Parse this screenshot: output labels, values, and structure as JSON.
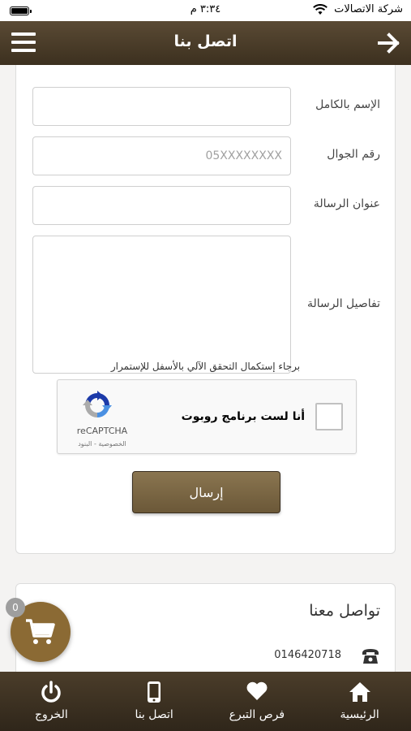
{
  "status_bar": {
    "carrier": "شركة الاتصالات",
    "time": "٣:٣٤ م"
  },
  "header": {
    "title": "اتصل بنا",
    "menu_icon": "hamburger-menu-icon",
    "back_icon": "arrow-right-icon"
  },
  "form": {
    "fields": [
      {
        "label": "الإسم بالكامل",
        "value": "",
        "placeholder": ""
      },
      {
        "label": "رقم الجوال",
        "value": "",
        "placeholder": "05XXXXXXXX"
      },
      {
        "label": "عنوان الرسالة",
        "value": "",
        "placeholder": ""
      }
    ],
    "details_label": "تفاصيل الرسالة",
    "captcha_hint": "برجاء إستكمال التحقق الآلي بالأسفل للإستمرار",
    "recaptcha": {
      "label": "أنا لست برنامج روبوت",
      "brand": "reCAPTCHA",
      "links": "الخصوصية - البنود",
      "checked": false
    },
    "submit_label": "إرسال"
  },
  "contact": {
    "title": "تواصل معنا",
    "phone": "0146420718"
  },
  "cart": {
    "count": "0"
  },
  "bottom_nav": {
    "items": [
      {
        "label": "الرئيسية",
        "icon": "home-icon"
      },
      {
        "label": "فرص التبرع",
        "icon": "heart-icon"
      },
      {
        "label": "اتصل بنا",
        "icon": "mobile-phone-icon"
      },
      {
        "label": "الخروج",
        "icon": "power-icon"
      }
    ]
  },
  "colors": {
    "header_brown": "#4a3c28",
    "accent_gold": "#8b6a34",
    "button_brown": "#7a6644",
    "background": "#f4f3f2"
  }
}
